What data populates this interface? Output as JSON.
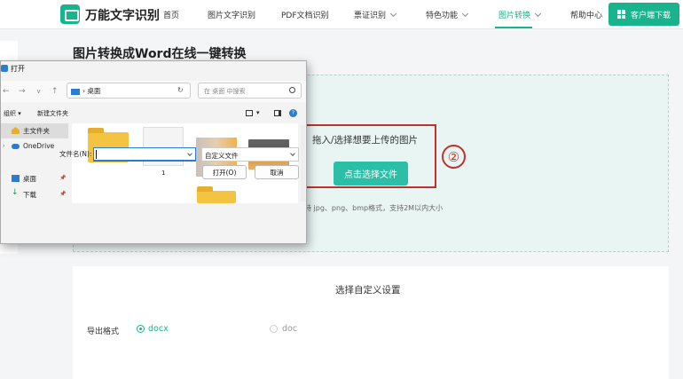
{
  "nav": {
    "brand": "万能文字识别",
    "items": [
      "首页",
      "图片文字识别",
      "PDF文档识别",
      "票证识别",
      "特色功能",
      "图片转换",
      "帮助中心"
    ],
    "download": "客户端下载"
  },
  "main": {
    "title": "图片转换成Word在线一键转换",
    "drop_text": "拖入/选择想要上传的图片",
    "choose_button": "点击选择文件",
    "support_text": "持 jpg、png、bmp格式，支持2M以内大小",
    "annotation": "②"
  },
  "settings": {
    "title": "选择自定义设置",
    "format_label": "导出格式",
    "options": [
      "docx",
      "doc"
    ],
    "selected": "docx"
  },
  "dialog": {
    "title": "打开",
    "address": "桌面",
    "search_placeholder": "在 桌面 中搜索",
    "toolbar": {
      "organize": "组织",
      "new_folder": "新建文件夹"
    },
    "sidebar": [
      "主文件夹",
      "OneDrive",
      "桌面",
      "下载"
    ],
    "file_label": "1",
    "filename_label": "文件名(N):",
    "filename_value": "",
    "filetype": "自定义文件",
    "open_button": "打开(O)",
    "cancel_button": "取消"
  },
  "colors": {
    "accent": "#19b38e",
    "annotation_red": "#c0312b"
  }
}
